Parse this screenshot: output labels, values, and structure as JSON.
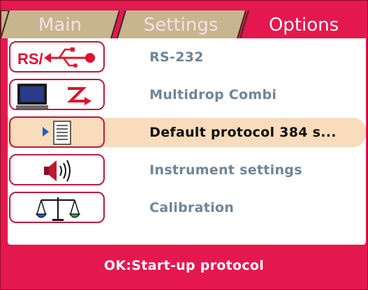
{
  "tabs": [
    {
      "label": "Main",
      "active": false
    },
    {
      "label": "Settings",
      "active": false
    },
    {
      "label": "Options",
      "active": true
    }
  ],
  "menu": {
    "items": [
      {
        "label": "RS-232",
        "icon": "rs232-usb-icon",
        "icon_text": "RS/",
        "selected": false
      },
      {
        "label": "Multidrop Combi",
        "icon": "monitor-multidrop-icon",
        "selected": false
      },
      {
        "label": "Default protocol 384 s...",
        "icon": "protocol-document-icon",
        "selected": true
      },
      {
        "label": "Instrument settings",
        "icon": "speaker-sound-icon",
        "selected": false
      },
      {
        "label": "Calibration",
        "icon": "balance-scale-icon",
        "selected": false
      }
    ]
  },
  "status": {
    "text": "OK:Start-up protocol"
  },
  "colors": {
    "frame": "#e4184e",
    "tab_inactive": "#c7b58f",
    "selection": "#f8dcbb",
    "label": "#6f8597",
    "label_selected": "#111111"
  }
}
